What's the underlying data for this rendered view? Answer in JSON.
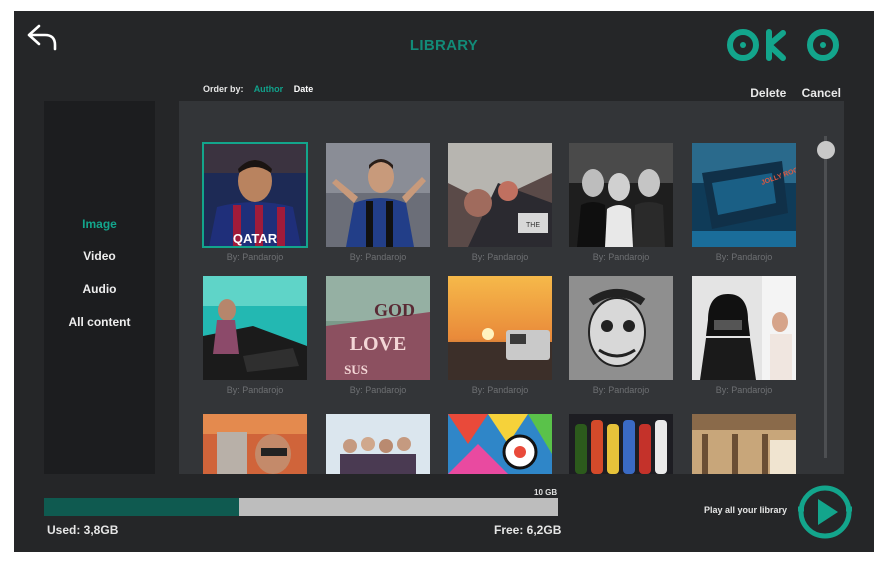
{
  "header": {
    "back_icon": "back-arrow-icon",
    "title": "LIBRARY",
    "logo_text": "OKO",
    "accent": "#13a58c"
  },
  "order": {
    "label": "Order by:",
    "options": [
      "Author",
      "Date"
    ],
    "selected": "Author"
  },
  "actions": {
    "delete": "Delete",
    "cancel": "Cancel"
  },
  "sidebar": {
    "items": [
      {
        "label": "Image",
        "active": true
      },
      {
        "label": "Video",
        "active": false
      },
      {
        "label": "Audio",
        "active": false
      },
      {
        "label": "All content",
        "active": false
      }
    ]
  },
  "grid": {
    "items": [
      {
        "caption": "By: Pandarojo",
        "selected": true
      },
      {
        "caption": "By: Pandarojo"
      },
      {
        "caption": "By: Pandarojo"
      },
      {
        "caption": "By: Pandarojo"
      },
      {
        "caption": "By: Pandarojo"
      },
      {
        "caption": "By: Pandarojo"
      },
      {
        "caption": "By: Pandarojo"
      },
      {
        "caption": "By: Pandarojo"
      },
      {
        "caption": "By: Pandarojo"
      },
      {
        "caption": "By: Pandarojo"
      }
    ]
  },
  "storage": {
    "capacity_label": "10 GB",
    "used_label": "Used: 3,8GB",
    "free_label": "Free: 6,2GB",
    "used_fraction": 0.38
  },
  "play": {
    "label": "Play all your library",
    "icon": "play-icon"
  }
}
